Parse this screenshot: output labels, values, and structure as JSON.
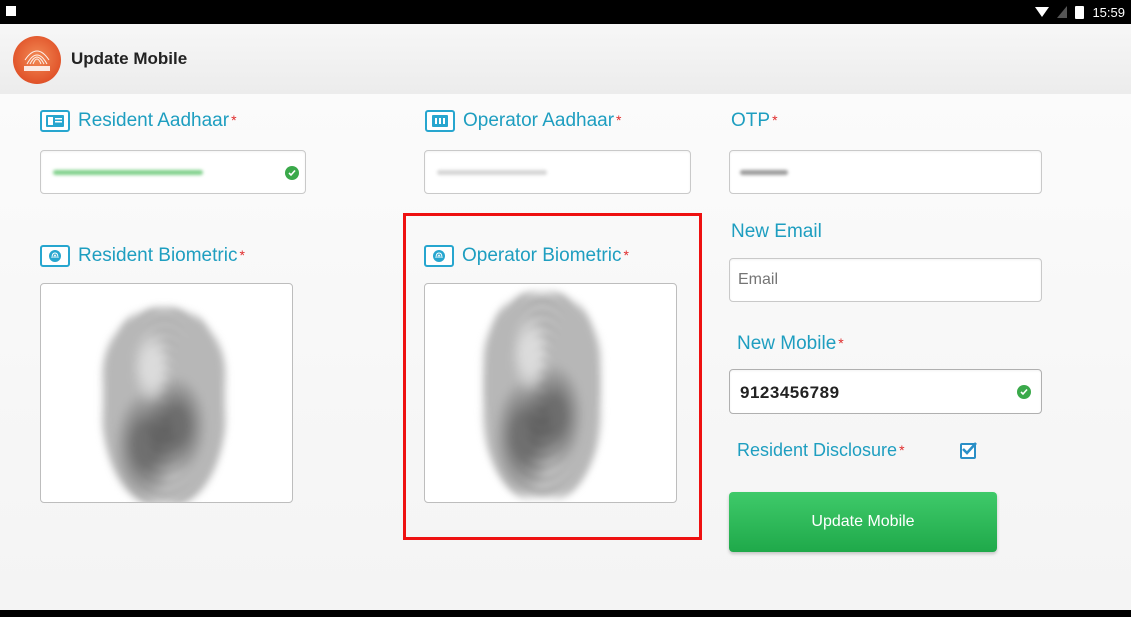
{
  "status_bar": {
    "time": "15:59",
    "icons": [
      "notification-icon",
      "wifi-icon",
      "signal-icon",
      "battery-icon"
    ]
  },
  "app_bar": {
    "logo": "aadhaar-logo",
    "logo_text": "AADHAAR",
    "title": "Update Mobile"
  },
  "form": {
    "resident_aadhaar": {
      "label": "Resident Aadhaar",
      "required_mark": "*",
      "icon": "id-card-icon",
      "value_masked": true,
      "verified": true
    },
    "operator_aadhaar": {
      "label": "Operator Aadhaar",
      "required_mark": "*",
      "icon": "keypad-icon",
      "value_masked": true
    },
    "otp": {
      "label": "OTP",
      "required_mark": "*",
      "value_masked": true
    },
    "resident_biometric": {
      "label": "Resident Biometric",
      "required_mark": "*",
      "icon": "fingerprint-icon"
    },
    "operator_biometric": {
      "label": "Operator Biometric",
      "required_mark": "*",
      "icon": "fingerprint-icon"
    },
    "new_email": {
      "label": "New Email",
      "placeholder": "Email"
    },
    "new_mobile": {
      "label": "New Mobile",
      "required_mark": "*",
      "value": "9123456789",
      "verified": true
    },
    "resident_disclosure": {
      "label": "Resident Disclosure",
      "required_mark": "*",
      "checked": true
    },
    "submit_label": "Update Mobile"
  },
  "colors": {
    "label": "#1e9ec0",
    "required": "#e02c2c",
    "button": "#25b04f",
    "highlight": "#ee1111",
    "check": "#3aa94a"
  }
}
